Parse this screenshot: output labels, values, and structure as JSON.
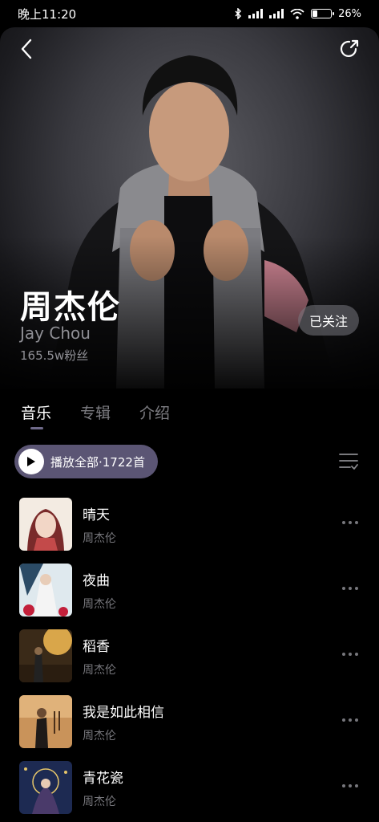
{
  "status_bar": {
    "time": "晚上11:20",
    "battery": "26%",
    "battery_level": 0.26
  },
  "artist": {
    "name_cn": "周杰伦",
    "name_en": "Jay Chou",
    "fans": "165.5w粉丝",
    "follow_label": "已关注"
  },
  "tabs": [
    {
      "label": "音乐",
      "active": true
    },
    {
      "label": "专辑",
      "active": false
    },
    {
      "label": "介绍",
      "active": false
    }
  ],
  "play_all": {
    "label": "播放全部·1722首"
  },
  "songs": [
    {
      "title": "晴天",
      "artist": "周杰伦"
    },
    {
      "title": "夜曲",
      "artist": "周杰伦"
    },
    {
      "title": "稻香",
      "artist": "周杰伦"
    },
    {
      "title": "我是如此相信",
      "artist": "周杰伦"
    },
    {
      "title": "青花瓷",
      "artist": "周杰伦"
    }
  ],
  "colors": {
    "accent": "#5b5574",
    "background": "#000000",
    "muted_text": "#77777c"
  }
}
